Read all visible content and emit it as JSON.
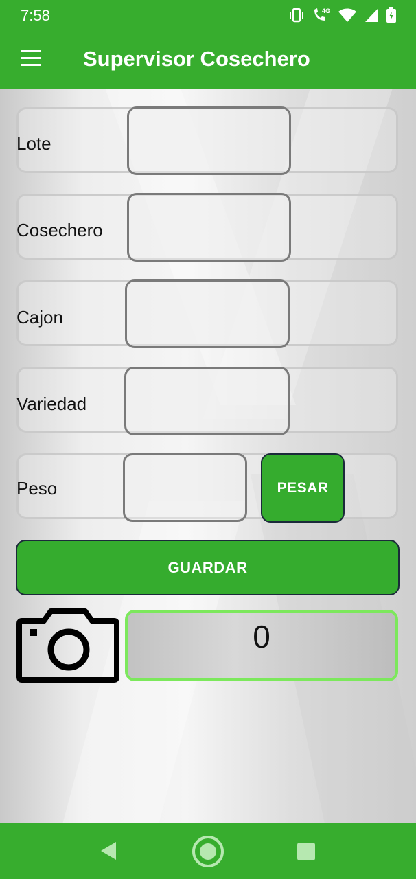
{
  "status_bar": {
    "time": "7:58",
    "network_label": "4G"
  },
  "app_bar": {
    "title": "Supervisor Cosechero",
    "menu_icon": "hamburger-icon"
  },
  "form": {
    "lote": {
      "label": "Lote",
      "value": ""
    },
    "cosechero": {
      "label": "Cosechero",
      "value": ""
    },
    "cajon": {
      "label": "Cajon",
      "value": ""
    },
    "variedad": {
      "label": "Variedad",
      "value": ""
    },
    "peso": {
      "label": "Peso",
      "value": ""
    },
    "pesar_label": "PESAR",
    "guardar_label": "GUARDAR"
  },
  "photo": {
    "icon": "camera-icon",
    "count": "0"
  },
  "nav_bar": {
    "back_icon": "back-triangle-icon",
    "home_icon": "home-circle-icon",
    "recents_icon": "recents-square-icon"
  },
  "colors": {
    "primary": "#37ad2e",
    "counter_border": "#7ce85c",
    "field_border": "#7a7a7a"
  }
}
